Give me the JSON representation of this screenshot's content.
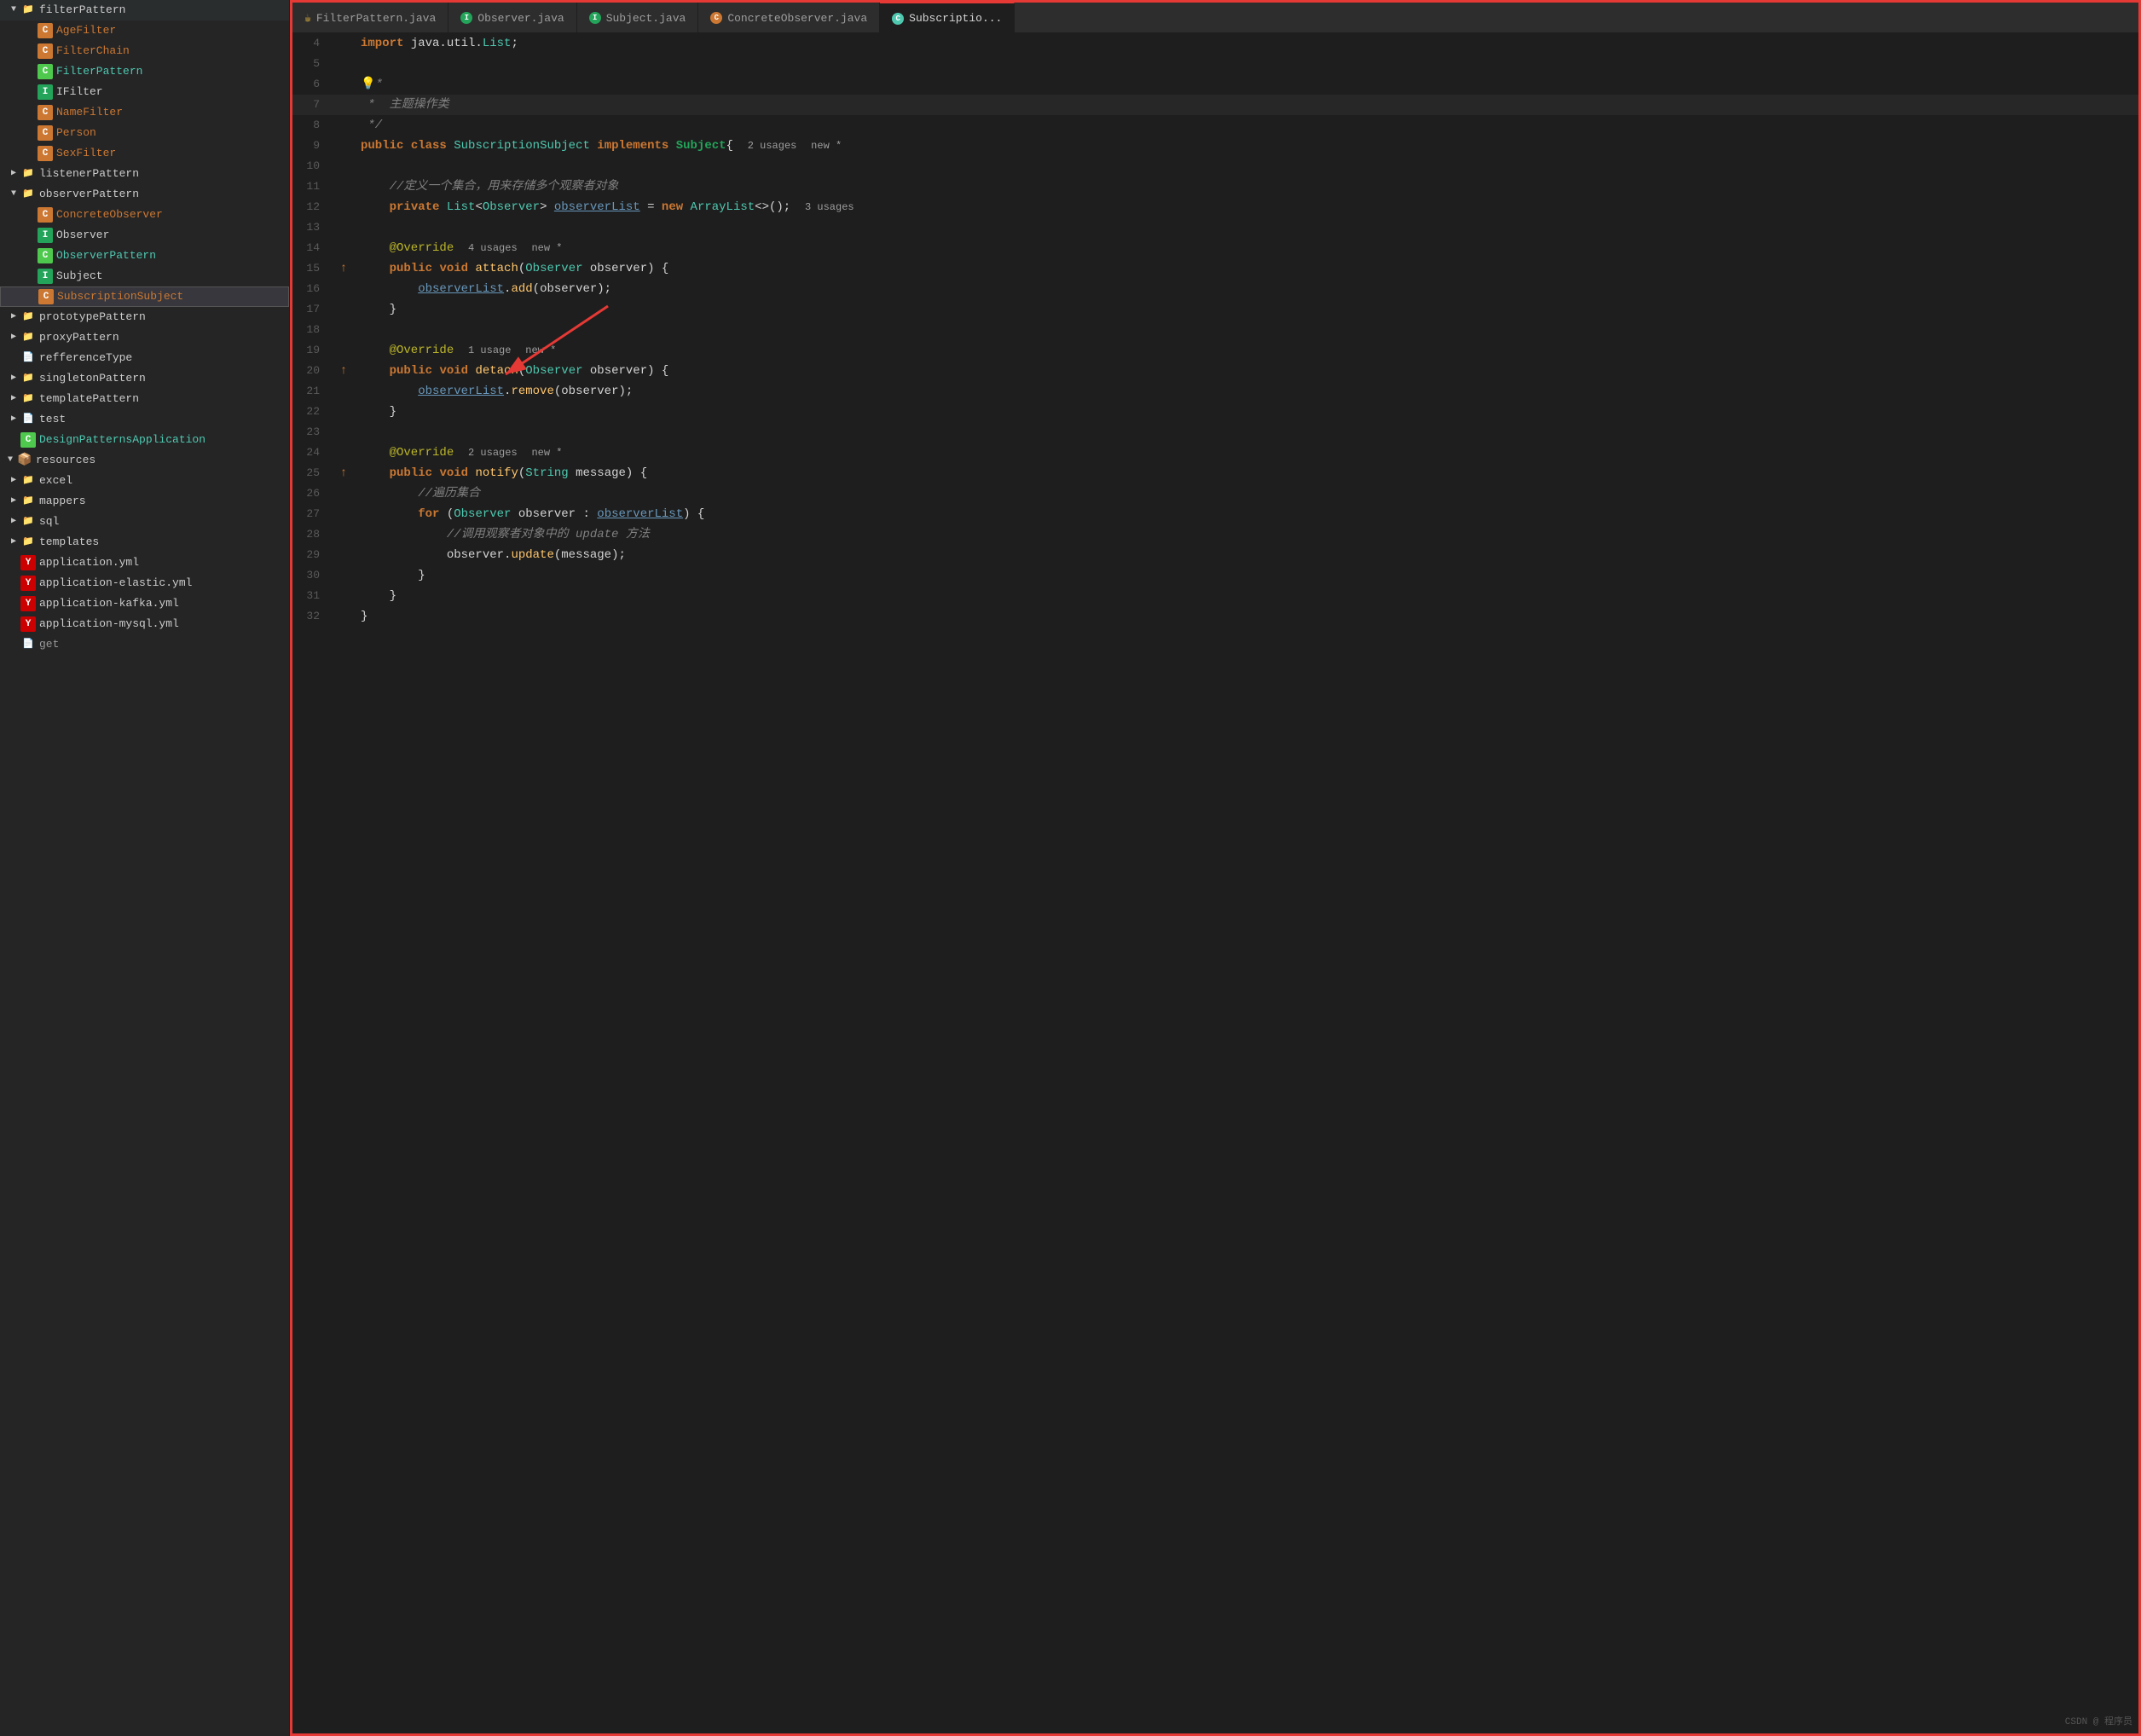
{
  "sidebar": {
    "items": [
      {
        "id": "filterPattern",
        "label": "filterPattern",
        "type": "folder",
        "level": 0,
        "expanded": true,
        "arrow": "▼"
      },
      {
        "id": "AgeFilter",
        "label": "AgeFilter",
        "type": "class-orange",
        "level": 1,
        "arrow": ""
      },
      {
        "id": "FilterChain",
        "label": "FilterChain",
        "type": "class-orange",
        "level": 1,
        "arrow": ""
      },
      {
        "id": "FilterPattern",
        "label": "FilterPattern",
        "type": "class-green",
        "level": 1,
        "arrow": ""
      },
      {
        "id": "IFilter",
        "label": "IFilter",
        "type": "interface",
        "level": 1,
        "arrow": ""
      },
      {
        "id": "NameFilter",
        "label": "NameFilter",
        "type": "class-orange",
        "level": 1,
        "arrow": ""
      },
      {
        "id": "Person",
        "label": "Person",
        "type": "class-orange",
        "level": 1,
        "arrow": ""
      },
      {
        "id": "SexFilter",
        "label": "SexFilter",
        "type": "class-orange",
        "level": 1,
        "arrow": ""
      },
      {
        "id": "listenerPattern",
        "label": "listenerPattern",
        "type": "folder",
        "level": 0,
        "expanded": false,
        "arrow": "▶"
      },
      {
        "id": "observerPattern",
        "label": "observerPattern",
        "type": "folder",
        "level": 0,
        "expanded": true,
        "arrow": "▼"
      },
      {
        "id": "ConcreteObserver",
        "label": "ConcreteObserver",
        "type": "class-orange",
        "level": 1,
        "arrow": ""
      },
      {
        "id": "Observer",
        "label": "Observer",
        "type": "interface",
        "level": 1,
        "arrow": ""
      },
      {
        "id": "ObserverPattern",
        "label": "ObserverPattern",
        "type": "class-green",
        "level": 1,
        "arrow": ""
      },
      {
        "id": "Subject",
        "label": "Subject",
        "type": "interface",
        "level": 1,
        "arrow": ""
      },
      {
        "id": "SubscriptionSubject",
        "label": "SubscriptionSubject",
        "type": "class-orange",
        "level": 1,
        "arrow": "",
        "selected": true
      },
      {
        "id": "prototypePattern",
        "label": "prototypePattern",
        "type": "folder",
        "level": 0,
        "expanded": false,
        "arrow": "▶"
      },
      {
        "id": "proxyPattern",
        "label": "proxyPattern",
        "type": "folder",
        "level": 0,
        "expanded": false,
        "arrow": "▶"
      },
      {
        "id": "refferenceType",
        "label": "refferenceType",
        "type": "folder-plain",
        "level": 0,
        "expanded": false,
        "arrow": ""
      },
      {
        "id": "singletonPattern",
        "label": "singletonPattern",
        "type": "folder",
        "level": 0,
        "expanded": false,
        "arrow": "▶"
      },
      {
        "id": "templatePattern",
        "label": "templatePattern",
        "type": "folder",
        "level": 0,
        "expanded": false,
        "arrow": "▶"
      },
      {
        "id": "test",
        "label": "test",
        "type": "folder-plain",
        "level": 0,
        "expanded": false,
        "arrow": "▶"
      },
      {
        "id": "DesignPatternsApplication",
        "label": "DesignPatternsApplication",
        "type": "class-green",
        "level": 0,
        "arrow": ""
      },
      {
        "id": "resources",
        "label": "resources",
        "type": "resources",
        "level": -1,
        "arrow": "▼"
      },
      {
        "id": "excel",
        "label": "excel",
        "type": "folder-plain",
        "level": 0,
        "arrow": "▶"
      },
      {
        "id": "mappers",
        "label": "mappers",
        "type": "folder-plain",
        "level": 0,
        "arrow": "▶"
      },
      {
        "id": "sql",
        "label": "sql",
        "type": "folder-plain",
        "level": 0,
        "arrow": "▶"
      },
      {
        "id": "templates",
        "label": "templates",
        "type": "folder-plain",
        "level": 0,
        "arrow": "▶"
      },
      {
        "id": "application.yml",
        "label": "application.yml",
        "type": "yaml",
        "level": 0,
        "arrow": ""
      },
      {
        "id": "application-elastic.yml",
        "label": "application-elastic.yml",
        "type": "yaml",
        "level": 0,
        "arrow": ""
      },
      {
        "id": "application-kafka.yml",
        "label": "application-kafka.yml",
        "type": "yaml",
        "level": 0,
        "arrow": ""
      },
      {
        "id": "application-mysql.yml",
        "label": "application-mysql.yml",
        "type": "yaml",
        "level": 0,
        "arrow": ""
      }
    ]
  },
  "tabs": [
    {
      "id": "FilterPattern.java",
      "label": "FilterPattern.java",
      "icon": "java",
      "active": false
    },
    {
      "id": "Observer.java",
      "label": "Observer.java",
      "icon": "interface",
      "active": false
    },
    {
      "id": "Subject.java",
      "label": "Subject.java",
      "icon": "interface",
      "active": false
    },
    {
      "id": "ConcreteObserver.java",
      "label": "ConcreteObserver.java",
      "icon": "class",
      "active": false
    },
    {
      "id": "SubscriptionSubject.java",
      "label": "Subscriptio...",
      "icon": "class-cyan",
      "active": true
    }
  ],
  "code": {
    "lines": [
      {
        "num": 4,
        "gutter": "",
        "content": "    import java.util.List;",
        "tokens": [
          {
            "t": "kw",
            "v": "import"
          },
          {
            "t": "pln",
            "v": " java.util."
          },
          {
            "t": "type",
            "v": "List"
          },
          {
            "t": "pln",
            "v": ";"
          }
        ]
      },
      {
        "num": 5,
        "gutter": "",
        "content": "",
        "tokens": []
      },
      {
        "num": 6,
        "gutter": "",
        "content": "💡*",
        "tokens": [
          {
            "t": "lit-bulb",
            "v": "💡"
          },
          {
            "t": "cmt",
            "v": "*"
          }
        ]
      },
      {
        "num": 7,
        "gutter": "",
        "content": " *  主题操作类",
        "tokens": [
          {
            "t": "cmt",
            "v": " *  主题操作类"
          }
        ]
      },
      {
        "num": 8,
        "gutter": "",
        "content": " */",
        "tokens": [
          {
            "t": "cmt",
            "v": " */"
          }
        ]
      },
      {
        "num": 9,
        "gutter": "",
        "content": "public class SubscriptionSubject implements Subject{  2 usages  new *",
        "tokens": [
          {
            "t": "kw",
            "v": "public"
          },
          {
            "t": "pln",
            "v": " "
          },
          {
            "t": "kw",
            "v": "class"
          },
          {
            "t": "pln",
            "v": " "
          },
          {
            "t": "type",
            "v": "SubscriptionSubject"
          },
          {
            "t": "pln",
            "v": " "
          },
          {
            "t": "kw",
            "v": "implements"
          },
          {
            "t": "pln",
            "v": " "
          },
          {
            "t": "iface",
            "v": "Subject"
          },
          {
            "t": "pln",
            "v": "{ "
          },
          {
            "t": "meta",
            "v": "2 usages"
          },
          {
            "t": "pln",
            "v": "  "
          },
          {
            "t": "meta",
            "v": "new *"
          }
        ]
      },
      {
        "num": 10,
        "gutter": "",
        "content": "",
        "tokens": []
      },
      {
        "num": 11,
        "gutter": "",
        "content": "    //定义一个集合，用来存储多个观察者对象",
        "tokens": [
          {
            "t": "cmt",
            "v": "    //定义一个集合，用来存储多个观察者对象"
          }
        ]
      },
      {
        "num": 12,
        "gutter": "",
        "content": "    private List<Observer> observerList = new ArrayList<>();  3 usages",
        "tokens": [
          {
            "t": "pln",
            "v": "    "
          },
          {
            "t": "kw",
            "v": "private"
          },
          {
            "t": "pln",
            "v": " "
          },
          {
            "t": "type",
            "v": "List"
          },
          {
            "t": "pln",
            "v": "<"
          },
          {
            "t": "type",
            "v": "Observer"
          },
          {
            "t": "pln",
            "v": "> "
          },
          {
            "t": "ref",
            "v": "observerList"
          },
          {
            "t": "pln",
            "v": " = "
          },
          {
            "t": "kw",
            "v": "new"
          },
          {
            "t": "pln",
            "v": " "
          },
          {
            "t": "type",
            "v": "ArrayList"
          },
          {
            "t": "pln",
            "v": "<>();  "
          },
          {
            "t": "meta",
            "v": "3 usages"
          }
        ]
      },
      {
        "num": 13,
        "gutter": "",
        "content": "",
        "tokens": []
      },
      {
        "num": 14,
        "gutter": "",
        "content": "    @Override  4 usages  new *",
        "tokens": [
          {
            "t": "ann",
            "v": "    @Override"
          },
          {
            "t": "pln",
            "v": "  "
          },
          {
            "t": "meta",
            "v": "4 usages"
          },
          {
            "t": "pln",
            "v": "  "
          },
          {
            "t": "meta",
            "v": "new *"
          }
        ]
      },
      {
        "num": 15,
        "gutter": "↑",
        "content": "    public void attach(Observer observer) {",
        "tokens": [
          {
            "t": "pln",
            "v": "    "
          },
          {
            "t": "kw",
            "v": "public"
          },
          {
            "t": "pln",
            "v": " "
          },
          {
            "t": "kw",
            "v": "void"
          },
          {
            "t": "pln",
            "v": " "
          },
          {
            "t": "mth",
            "v": "attach"
          },
          {
            "t": "pln",
            "v": "("
          },
          {
            "t": "type",
            "v": "Observer"
          },
          {
            "t": "pln",
            "v": " observer) {"
          }
        ]
      },
      {
        "num": 16,
        "gutter": "",
        "content": "        observerList.add(observer);",
        "tokens": [
          {
            "t": "pln",
            "v": "        "
          },
          {
            "t": "ref",
            "v": "observerList"
          },
          {
            "t": "pln",
            "v": "."
          },
          {
            "t": "mth",
            "v": "add"
          },
          {
            "t": "pln",
            "v": "(observer);"
          }
        ]
      },
      {
        "num": 17,
        "gutter": "",
        "content": "    }",
        "tokens": [
          {
            "t": "pln",
            "v": "    }"
          }
        ]
      },
      {
        "num": 18,
        "gutter": "",
        "content": "",
        "tokens": []
      },
      {
        "num": 19,
        "gutter": "",
        "content": "    @Override  1 usage  new *",
        "tokens": [
          {
            "t": "ann",
            "v": "    @Override"
          },
          {
            "t": "pln",
            "v": "  "
          },
          {
            "t": "meta",
            "v": "1 usage"
          },
          {
            "t": "pln",
            "v": "  "
          },
          {
            "t": "meta",
            "v": "new *"
          }
        ]
      },
      {
        "num": 20,
        "gutter": "↑",
        "content": "    public void detach(Observer observer) {",
        "tokens": [
          {
            "t": "pln",
            "v": "    "
          },
          {
            "t": "kw",
            "v": "public"
          },
          {
            "t": "pln",
            "v": " "
          },
          {
            "t": "kw",
            "v": "void"
          },
          {
            "t": "pln",
            "v": " "
          },
          {
            "t": "mth",
            "v": "detach"
          },
          {
            "t": "pln",
            "v": "("
          },
          {
            "t": "type",
            "v": "Observer"
          },
          {
            "t": "pln",
            "v": " observer) {"
          }
        ]
      },
      {
        "num": 21,
        "gutter": "",
        "content": "        observerList.remove(observer);",
        "tokens": [
          {
            "t": "pln",
            "v": "        "
          },
          {
            "t": "ref",
            "v": "observerList"
          },
          {
            "t": "pln",
            "v": "."
          },
          {
            "t": "mth",
            "v": "remove"
          },
          {
            "t": "pln",
            "v": "(observer);"
          }
        ]
      },
      {
        "num": 22,
        "gutter": "",
        "content": "    }",
        "tokens": [
          {
            "t": "pln",
            "v": "    }"
          }
        ]
      },
      {
        "num": 23,
        "gutter": "",
        "content": "",
        "tokens": []
      },
      {
        "num": 24,
        "gutter": "",
        "content": "    @Override  2 usages  new *",
        "tokens": [
          {
            "t": "ann",
            "v": "    @Override"
          },
          {
            "t": "pln",
            "v": "  "
          },
          {
            "t": "meta",
            "v": "2 usages"
          },
          {
            "t": "pln",
            "v": "  "
          },
          {
            "t": "meta",
            "v": "new *"
          }
        ]
      },
      {
        "num": 25,
        "gutter": "↑",
        "content": "    public void notify(String message) {",
        "tokens": [
          {
            "t": "pln",
            "v": "    "
          },
          {
            "t": "kw",
            "v": "public"
          },
          {
            "t": "pln",
            "v": " "
          },
          {
            "t": "kw",
            "v": "void"
          },
          {
            "t": "pln",
            "v": " "
          },
          {
            "t": "mth",
            "v": "notify"
          },
          {
            "t": "pln",
            "v": "("
          },
          {
            "t": "type",
            "v": "String"
          },
          {
            "t": "pln",
            "v": " message) {"
          }
        ]
      },
      {
        "num": 26,
        "gutter": "",
        "content": "        //遍历集合",
        "tokens": [
          {
            "t": "cmt",
            "v": "        //遍历集合"
          }
        ]
      },
      {
        "num": 27,
        "gutter": "",
        "content": "        for (Observer observer : observerList) {",
        "tokens": [
          {
            "t": "pln",
            "v": "        "
          },
          {
            "t": "kw",
            "v": "for"
          },
          {
            "t": "pln",
            "v": " ("
          },
          {
            "t": "type",
            "v": "Observer"
          },
          {
            "t": "pln",
            "v": " observer : "
          },
          {
            "t": "ref",
            "v": "observerList"
          },
          {
            "t": "pln",
            "v": ") {"
          }
        ]
      },
      {
        "num": 28,
        "gutter": "",
        "content": "            //调用观察者对象中的 update 方法",
        "tokens": [
          {
            "t": "cmt",
            "v": "            //调用观察者对象中的 update 方法"
          }
        ]
      },
      {
        "num": 29,
        "gutter": "",
        "content": "            observer.update(message);",
        "tokens": [
          {
            "t": "pln",
            "v": "            observer."
          },
          {
            "t": "mth",
            "v": "update"
          },
          {
            "t": "pln",
            "v": "(message);"
          }
        ]
      },
      {
        "num": 30,
        "gutter": "",
        "content": "        }",
        "tokens": [
          {
            "t": "pln",
            "v": "        }"
          }
        ]
      },
      {
        "num": 31,
        "gutter": "",
        "content": "    }",
        "tokens": [
          {
            "t": "pln",
            "v": "    }"
          }
        ]
      },
      {
        "num": 32,
        "gutter": "",
        "content": "}",
        "tokens": [
          {
            "t": "pln",
            "v": "}"
          }
        ]
      }
    ]
  },
  "watermark": "CSDN @ 程序员",
  "colors": {
    "border_highlight": "#e53935",
    "sidebar_bg": "#252526",
    "editor_bg": "#1e1e1e",
    "tab_active_bg": "#1e1e1e",
    "selected_item_bg": "#37373d"
  }
}
